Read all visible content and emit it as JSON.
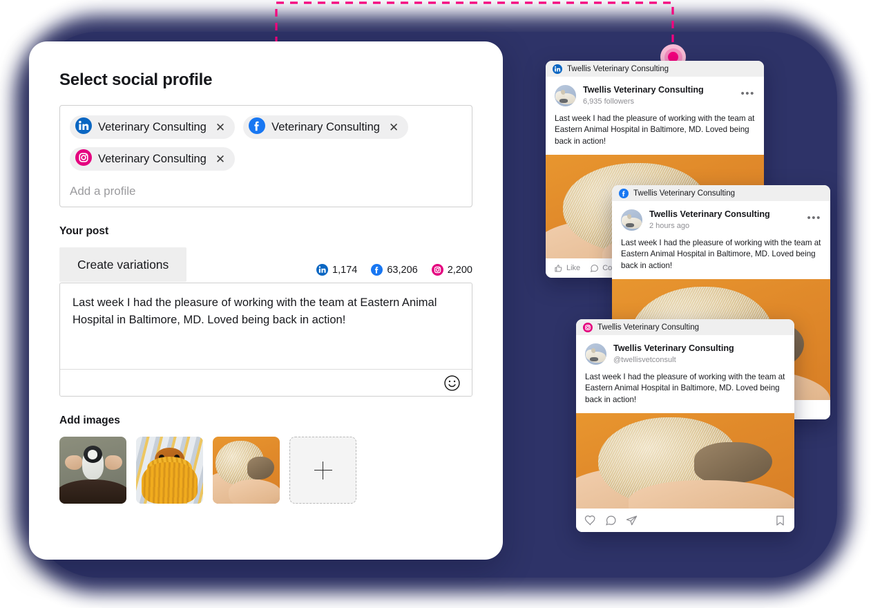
{
  "composer": {
    "title": "Select social profile",
    "profile_box": {
      "chips": [
        {
          "network": "linkedin",
          "icon": "linkedin-icon",
          "label": "Veterinary Consulting",
          "remove": "✕"
        },
        {
          "network": "facebook",
          "icon": "facebook-icon",
          "label": "Veterinary Consulting",
          "remove": "✕"
        },
        {
          "network": "instagram",
          "icon": "instagram-icon",
          "label": "Veterinary Consulting",
          "remove": "✕"
        }
      ],
      "add_placeholder": "Add a profile"
    },
    "post_label": "Your post",
    "variations_button": "Create variations",
    "counters": [
      {
        "network": "linkedin",
        "icon": "linkedin-icon",
        "value": "1,174"
      },
      {
        "network": "facebook",
        "icon": "facebook-icon",
        "value": "63,206"
      },
      {
        "network": "instagram",
        "icon": "instagram-icon",
        "value": "2,200"
      }
    ],
    "post_text": "Last week I had the pleasure of working with the team at Eastern Animal Hospital in Baltimore, MD. Loved being back in action!",
    "emoji_button": "emoji-smiley-icon",
    "images_label": "Add images",
    "thumbnails": [
      {
        "name": "penguin-figurine-thumbnail",
        "alt": "Hands placing a penguin figurine on a person's head"
      },
      {
        "name": "dachshund-scarf-thumbnail",
        "alt": "Dachshund wrapped in a yellow knit scarf"
      },
      {
        "name": "hedgehog-thumbnail",
        "alt": "Hedgehog held in a hand on orange background"
      }
    ],
    "add_image_button": "plus-icon"
  },
  "previews": [
    {
      "network": "linkedin",
      "header_icon": "linkedin-icon",
      "header_name": "Twellis Veterinary Consulting",
      "author": "Twellis Veterinary Consulting",
      "meta": "6,935 followers",
      "more": "•••",
      "text": "Last week I had the pleasure of working with the team at Eastern Animal Hospital in Baltimore, MD. Loved being back in action!",
      "photo_alt": "Hedgehog on orange background",
      "actions": [
        {
          "icon": "thumbs-up-icon",
          "label": "Like"
        },
        {
          "icon": "comment-icon",
          "label": "Comment"
        }
      ]
    },
    {
      "network": "facebook",
      "header_icon": "facebook-icon",
      "header_name": "Twellis Veterinary Consulting",
      "author": "Twellis Veterinary Consulting",
      "meta": "2 hours ago",
      "more": "•••",
      "text": "Last week I had the pleasure of working with the team at Eastern Animal Hospital in Baltimore, MD. Loved being back in action!",
      "photo_alt": "Hedgehog on orange background",
      "actions": []
    },
    {
      "network": "instagram",
      "header_icon": "instagram-icon",
      "header_name": "Twellis Veterinary Consulting",
      "author": "Twellis Veterinary Consulting",
      "meta": "@twellisvetconsult",
      "more": "",
      "text": "Last week I had the pleasure of working with the team at Eastern Animal Hospital in Baltimore, MD. Loved being back in action!",
      "photo_alt": "Hedgehog on orange background",
      "actions": [
        {
          "icon": "heart-icon",
          "label": ""
        },
        {
          "icon": "comment-icon",
          "label": ""
        },
        {
          "icon": "share-icon",
          "label": ""
        },
        {
          "icon": "bookmark-icon",
          "label": ""
        }
      ]
    }
  ],
  "colors": {
    "backdrop_navy": "#2e3368",
    "accent_pink": "#f5007e",
    "linkedin_blue": "#0a66c2",
    "facebook_blue": "#1877f2",
    "instagram_pink": "#e4007f",
    "chip_gray": "#efeff0",
    "button_gray": "#eeeeee"
  },
  "connector": {
    "name": "dashed-connector",
    "color": "#f5007e",
    "dot": "pink-marker-dot"
  }
}
